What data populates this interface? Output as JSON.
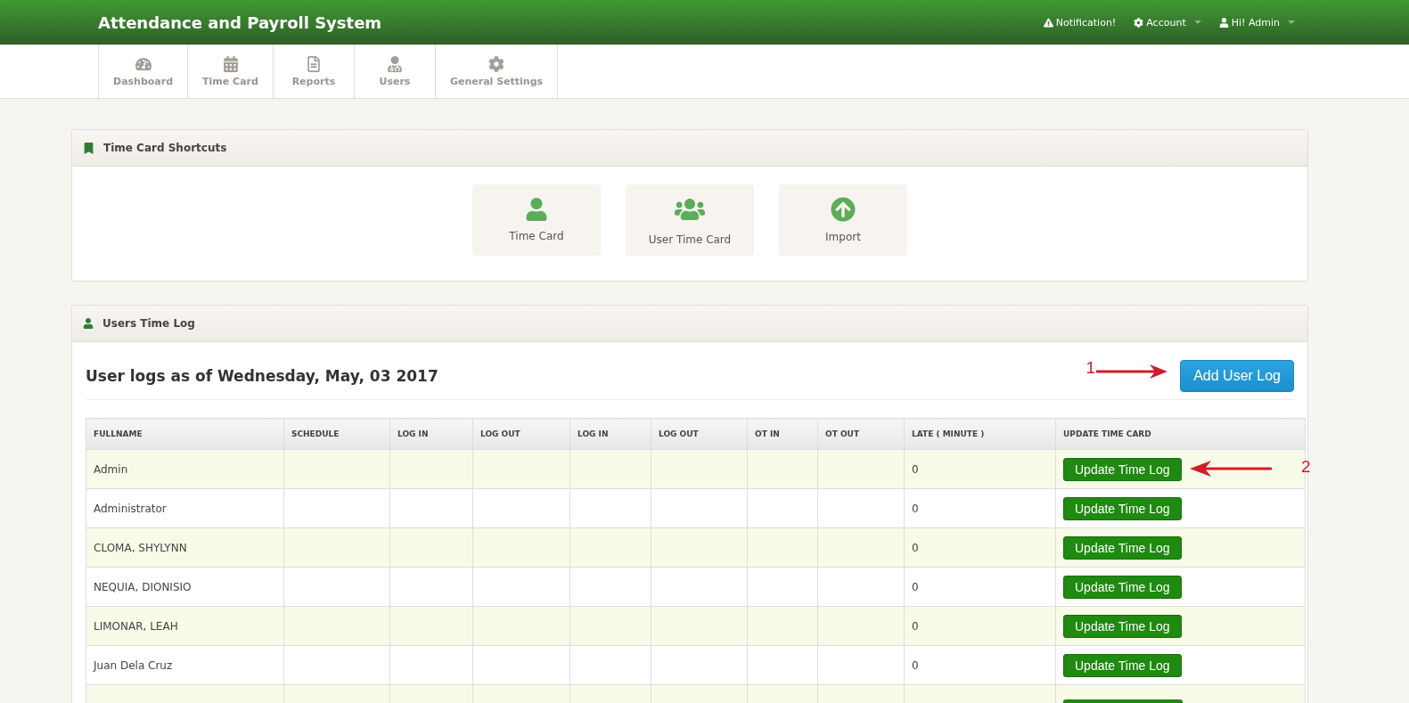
{
  "header": {
    "title": "Attendance and Payroll System",
    "menu": [
      {
        "kind": "alert",
        "label": "Notification!",
        "dropdown": false
      },
      {
        "kind": "gear",
        "label": "Account",
        "dropdown": true
      },
      {
        "kind": "user",
        "label": "Hi! Admin",
        "dropdown": true
      }
    ]
  },
  "nav": [
    {
      "kind": "dashboard",
      "label": "Dashboard"
    },
    {
      "kind": "calendar",
      "label": "Time Card"
    },
    {
      "kind": "file",
      "label": "Reports"
    },
    {
      "kind": "users",
      "label": "Users"
    },
    {
      "kind": "gear",
      "label": "General Settings"
    }
  ],
  "shortcuts_panel": {
    "title": "Time Card Shortcuts",
    "items": [
      {
        "kind": "user",
        "label": "Time Card"
      },
      {
        "kind": "group",
        "label": "User Time Card"
      },
      {
        "kind": "upload",
        "label": "Import"
      }
    ]
  },
  "log_panel": {
    "title": "Users Time Log",
    "heading": "User logs as of Wednesday, May, 03 2017",
    "add_button": "Add User Log",
    "table": {
      "columns": [
        "FULLNAME",
        "SCHEDULE",
        "LOG IN",
        "LOG OUT",
        "LOG IN",
        "LOG OUT",
        "OT IN",
        "OT OUT",
        "LATE ( MINUTE )",
        "UPDATE TIME CARD"
      ],
      "rows": [
        {
          "kind": "full",
          "fullname": "Admin",
          "late": "0",
          "action": "Update Time Log"
        },
        {
          "kind": "full",
          "fullname": "Administrator",
          "late": "0",
          "action": "Update Time Log"
        },
        {
          "kind": "full",
          "fullname": "CLOMA, SHYLYNN",
          "late": "0",
          "action": "Update Time Log"
        },
        {
          "kind": "full",
          "fullname": "NEQUIA, DIONISIO",
          "late": "0",
          "action": "Update Time Log"
        },
        {
          "kind": "full",
          "fullname": "LIMONAR, LEAH",
          "late": "0",
          "action": "Update Time Log"
        },
        {
          "kind": "full",
          "fullname": "Juan Dela Cruz",
          "late": "0",
          "action": "Update Time Log"
        },
        {
          "kind": "partial"
        }
      ]
    }
  },
  "annotations": [
    {
      "label": "1",
      "kind": "add"
    },
    {
      "label": "2",
      "kind": "update"
    }
  ]
}
